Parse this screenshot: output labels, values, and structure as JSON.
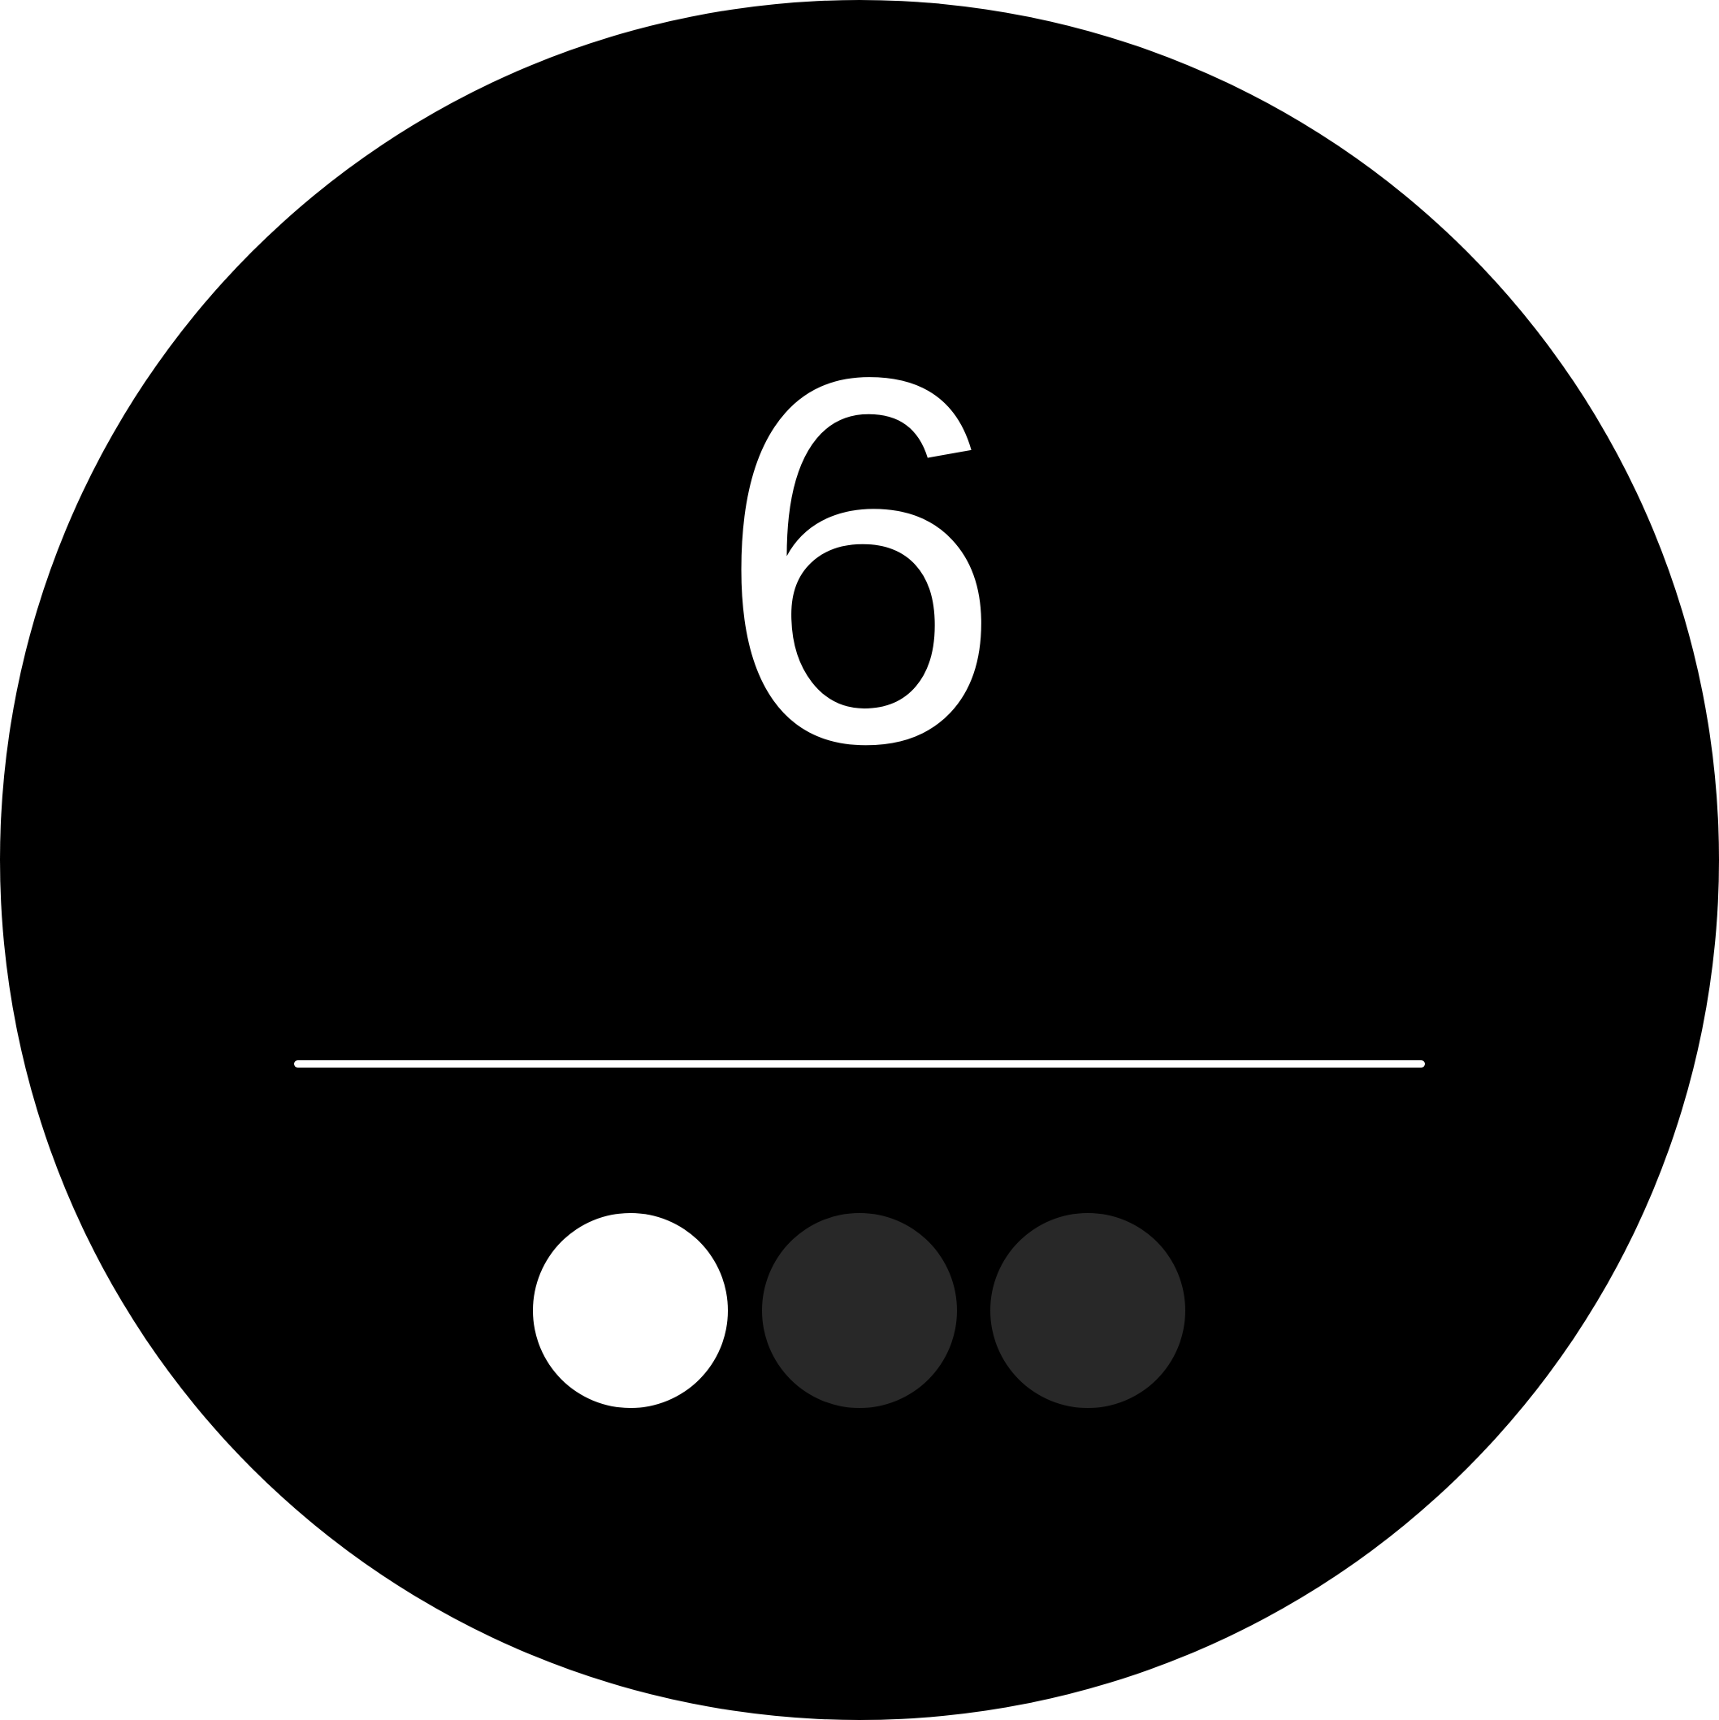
{
  "indicator": {
    "value": "6"
  },
  "pager": {
    "current_index": 0,
    "count": 3
  },
  "colors": {
    "badge_background": "#000000",
    "foreground": "#ffffff",
    "dot_active": "#ffffff",
    "dot_inactive": "#282828"
  }
}
